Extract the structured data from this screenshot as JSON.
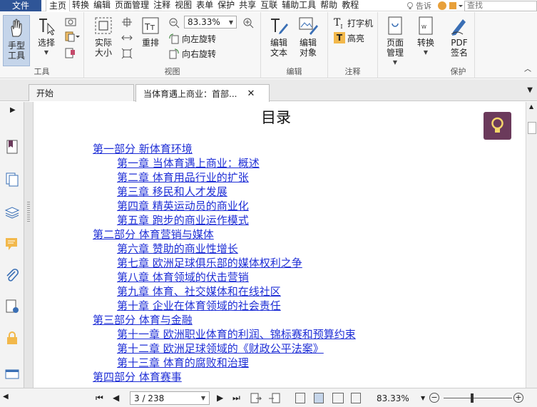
{
  "menubar": {
    "file": "文件",
    "items": [
      "主页",
      "转换",
      "编辑",
      "页面管理",
      "注释",
      "视图",
      "表单",
      "保护",
      "共享",
      "互联",
      "辅助工具",
      "帮助",
      "教程"
    ],
    "active_index": 0,
    "tell_me": "告诉",
    "search_placeholder": "查找"
  },
  "ribbon": {
    "tools_group": {
      "label": "工具",
      "hand": "手型\n工具",
      "select": "选择"
    },
    "view_group": {
      "label": "视图",
      "actual_size": "实际\n大小",
      "reflow": "重排",
      "zoom_value": "83.33%",
      "rotate_left": "向左旋转",
      "rotate_right": "向右旋转"
    },
    "edit_group": {
      "label": "编辑",
      "edit_text": "编辑\n文本",
      "edit_object": "编辑\n对象"
    },
    "comment_group": {
      "label": "注释",
      "typewriter": "打字机",
      "highlight": "高亮"
    },
    "page_group": {
      "page_manage": "页面\n管理",
      "convert": "转换"
    },
    "protect_group": {
      "label": "保护",
      "pdf_sign": "PDF\n签名"
    }
  },
  "tabs": [
    {
      "label": "开始"
    },
    {
      "label": "当体育遇上商业：首部...",
      "close": "✕"
    }
  ],
  "document": {
    "title": "目录",
    "toc": [
      {
        "level": "part",
        "text": "第一部分 新体育环境"
      },
      {
        "level": "ch",
        "text": "第一章 当体育遇上商业：概述"
      },
      {
        "level": "ch",
        "text": "第二章 体育用品行业的扩张"
      },
      {
        "level": "ch",
        "text": "第三章 移民和人才发展"
      },
      {
        "level": "ch",
        "text": "第四章 精英运动员的商业化"
      },
      {
        "level": "ch",
        "text": "第五章 跑步的商业运作模式"
      },
      {
        "level": "part",
        "text": "第二部分 体育营销与媒体"
      },
      {
        "level": "ch",
        "text": "第六章 赞助的商业性增长"
      },
      {
        "level": "ch",
        "text": "第七章 欧洲足球俱乐部的媒体权利之争"
      },
      {
        "level": "ch",
        "text": "第八章 体育领域的伏击营销"
      },
      {
        "level": "ch",
        "text": "第九章 体育、社交媒体和在线社区"
      },
      {
        "level": "ch",
        "text": "第十章 企业在体育领域的社会责任"
      },
      {
        "level": "part",
        "text": "第三部分 体育与金融"
      },
      {
        "level": "ch",
        "text": "第十一章 欧洲职业体育的利润、锦标赛和预算约束"
      },
      {
        "level": "ch",
        "text": "第十二章 欧洲足球领域的《财政公平法案》"
      },
      {
        "level": "ch",
        "text": "第十三章 体育的腐败和治理"
      },
      {
        "level": "part",
        "text": "第四部分 体育赛事"
      }
    ]
  },
  "statusbar": {
    "page": "3 / 238",
    "zoom": "83.33%"
  },
  "colors": {
    "file_tab": "#2f5597",
    "link": "#1f2fd6",
    "bulb": "#6b3a5b"
  }
}
